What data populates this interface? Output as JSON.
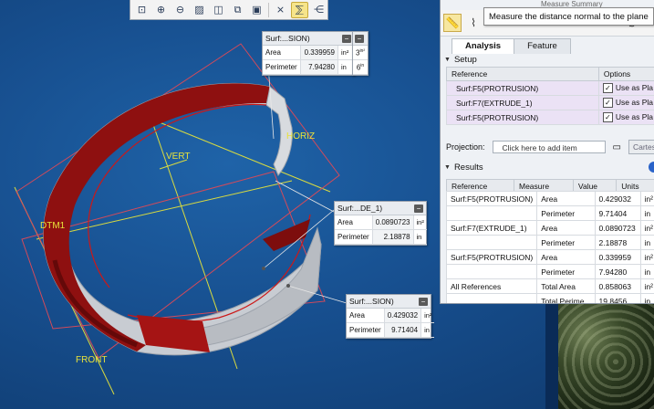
{
  "toolbar": {
    "icons": [
      "zoom-fit-icon",
      "zoom-in-icon",
      "zoom-out-icon",
      "repaint-icon",
      "display-style-icon",
      "saved-orientation-icon",
      "view-manager-icon",
      "datum-display-icon",
      "annotation-display-icon",
      "spin-center-icon"
    ],
    "active": "annotation-display-icon"
  },
  "model_labels": {
    "horiz": "HORIZ",
    "vert": "VERT",
    "dtm1": "DTM1",
    "front": "FRONT"
  },
  "callouts": [
    {
      "title": "Surf:...SION)",
      "rows": [
        {
          "label": "Area",
          "value": "0.339959",
          "unit": "in²"
        },
        {
          "label": "Perimeter",
          "value": "7.94280",
          "unit": "in"
        }
      ],
      "extra_rows": [
        {
          "value": "3",
          "unit": "in²"
        },
        {
          "value": "6",
          "unit": "in"
        }
      ]
    },
    {
      "title": "Surf:...DE_1)",
      "rows": [
        {
          "label": "Area",
          "value": "0.0890723",
          "unit": "in²"
        },
        {
          "label": "Perimeter",
          "value": "2.18878",
          "unit": "in"
        }
      ]
    },
    {
      "title": "Surf:...SION)",
      "rows": [
        {
          "label": "Area",
          "value": "0.429032",
          "unit": "in²"
        },
        {
          "label": "Perimeter",
          "value": "9.71404",
          "unit": "in"
        }
      ]
    }
  ],
  "panel": {
    "header_fragment": "Measure Summary",
    "tooltip": "Measure the distance normal to the plane",
    "tabs": [
      "Analysis",
      "Feature"
    ],
    "setup_label": "Setup",
    "setup_headers": [
      "Reference",
      "Options"
    ],
    "setup_rows": [
      {
        "ref": "Surf:F5(PROTRUSION)",
        "option": "Use as Pla"
      },
      {
        "ref": "Surf:F7(EXTRUDE_1)",
        "option": "Use as Pla"
      },
      {
        "ref": "Surf:F5(PROTRUSION)",
        "option": "Use as Pla"
      }
    ],
    "projection_label": "Projection:",
    "projection_placeholder": "Click here to add item",
    "cartesian": "Cartesia",
    "results_label": "Results",
    "results_headers": [
      "Reference",
      "Measure",
      "Value",
      "Units"
    ],
    "results": [
      {
        "ref": "Surf:F5(PROTRUSION)",
        "measure": "Area",
        "value": "0.429032",
        "unit": "in²"
      },
      {
        "ref": "",
        "measure": "Perimeter",
        "value": "9.71404",
        "unit": "in"
      },
      {
        "ref": "Surf:F7(EXTRUDE_1)",
        "measure": "Area",
        "value": "0.0890723",
        "unit": "in²"
      },
      {
        "ref": "",
        "measure": "Perimeter",
        "value": "2.18878",
        "unit": "in"
      },
      {
        "ref": "Surf:F5(PROTRUSION)",
        "measure": "Area",
        "value": "0.339959",
        "unit": "in²"
      },
      {
        "ref": "",
        "measure": "Perimeter",
        "value": "7.94280",
        "unit": "in"
      },
      {
        "ref": "All References",
        "measure": "Total Area",
        "value": "0.858063",
        "unit": "in²"
      },
      {
        "ref": "",
        "measure": "Total Perime...",
        "value": "19.8456",
        "unit": "in"
      }
    ]
  }
}
